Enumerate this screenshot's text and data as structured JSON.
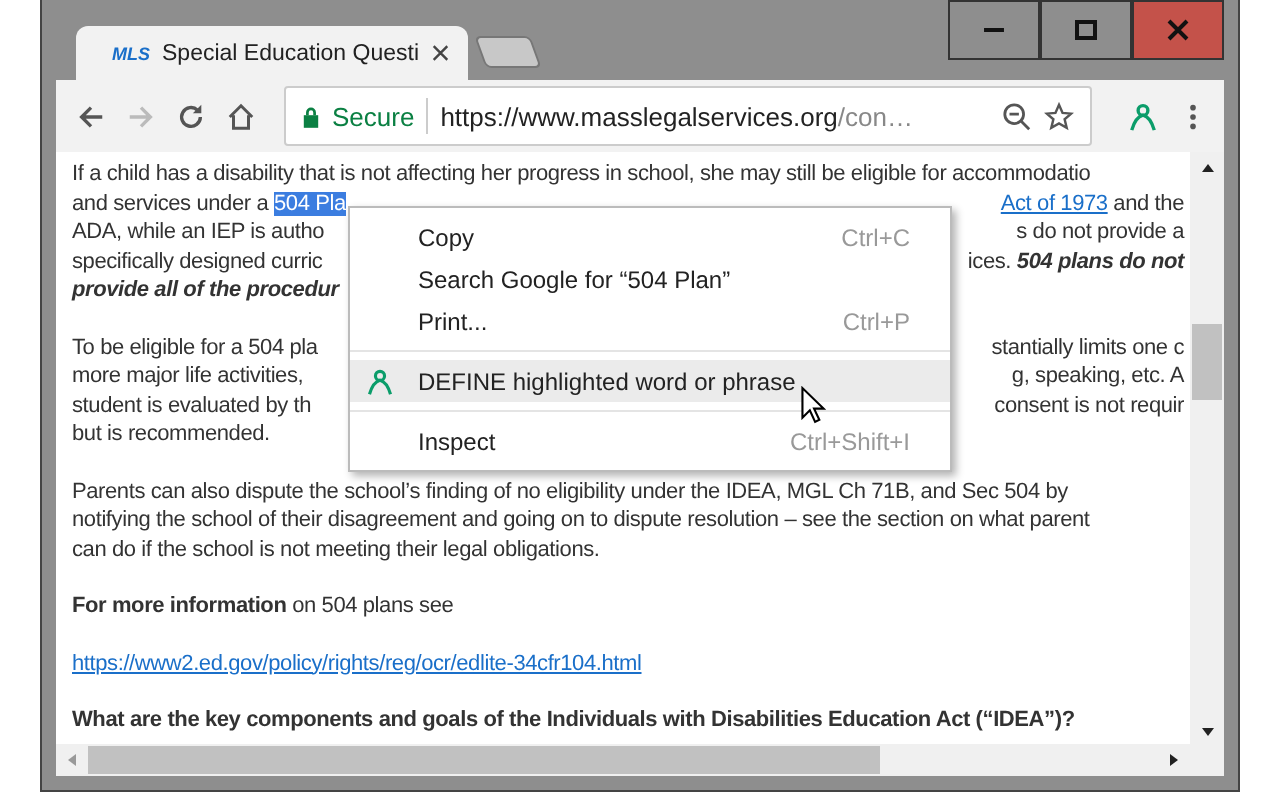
{
  "tab": {
    "favicon": "MLS",
    "title": "Special Education Questi",
    "selected": true
  },
  "address": {
    "secure_label": "Secure",
    "url_host": "https://www.masslegalservices.org",
    "url_path": "/con…"
  },
  "content": {
    "paragraphs": [
      {
        "lines": [
          {
            "left": [
              {
                "kind": "plain",
                "text": "If a child has a disability that is not affecting her progress in school, she may still be eligible for accommodatio"
              }
            ]
          },
          {
            "left": [
              {
                "kind": "plain",
                "text": "and services under a "
              },
              {
                "kind": "highlight",
                "text": "504 Pla"
              }
            ],
            "right": [
              {
                "kind": "link",
                "text": "Act of 1973"
              },
              {
                "kind": "plain",
                "text": " and the"
              }
            ]
          },
          {
            "left": [
              {
                "kind": "plain",
                "text": "ADA, while an IEP is autho"
              }
            ],
            "right": [
              {
                "kind": "plain",
                "text": "s do not provide a"
              }
            ]
          },
          {
            "left": [
              {
                "kind": "plain",
                "text": "specifically designed curric"
              }
            ],
            "right": [
              {
                "kind": "plain",
                "text": "ices. "
              },
              {
                "kind": "bold_italic",
                "text": "504 plans do not"
              }
            ]
          },
          {
            "left": [
              {
                "kind": "bold_italic",
                "text": "provide all of the  procedur"
              }
            ]
          }
        ]
      },
      {
        "lines": [
          {
            "left": [
              {
                "kind": "plain",
                "text": "To be eligible for a 504 pla"
              }
            ],
            "right": [
              {
                "kind": "plain",
                "text": "stantially limits one c"
              }
            ]
          },
          {
            "left": [
              {
                "kind": "plain",
                "text": "more major life activities,"
              }
            ],
            "right": [
              {
                "kind": "plain",
                "text": "g, speaking, etc. A"
              }
            ]
          },
          {
            "left": [
              {
                "kind": "plain",
                "text": "student is evaluated by th"
              }
            ],
            "right": [
              {
                "kind": "plain",
                "text": "consent is not requir"
              }
            ]
          },
          {
            "left": [
              {
                "kind": "plain",
                "text": "but is recommended."
              }
            ]
          }
        ]
      },
      {
        "lines": [
          {
            "left": [
              {
                "kind": "plain",
                "text": "Parents can also dispute the school’s finding of no eligibility under the IDEA, MGL Ch 71B, and Sec 504  by"
              }
            ]
          },
          {
            "left": [
              {
                "kind": "plain",
                "text": "notifying the school of their disagreement and going on to dispute resolution – see the section on what parent"
              }
            ]
          },
          {
            "left": [
              {
                "kind": "plain",
                "text": "can do if the school is not meeting their legal obligations."
              }
            ]
          }
        ]
      },
      {
        "lines": [
          {
            "left": [
              {
                "kind": "bold",
                "text": "For more information"
              },
              {
                "kind": "plain",
                "text": " on 504 plans see"
              }
            ]
          }
        ]
      },
      {
        "lines": [
          {
            "left": [
              {
                "kind": "link",
                "text": "https://www2.ed.gov/policy/rights/reg/ocr/edlite-34cfr104.html"
              }
            ]
          }
        ]
      },
      {
        "lines": [
          {
            "left": [
              {
                "kind": "bold",
                "text": "What are the key components and goals of the Individuals with Disabilities Education Act (“IDEA”)?"
              }
            ]
          }
        ]
      }
    ]
  },
  "context_menu": {
    "items": [
      {
        "kind": "item",
        "label": "Copy",
        "shortcut": "Ctrl+C",
        "selected": false
      },
      {
        "kind": "item",
        "label": "Search Google for “504 Plan”",
        "selected": false
      },
      {
        "kind": "item",
        "label": "Print...",
        "shortcut": "Ctrl+P",
        "selected": false
      },
      {
        "kind": "separator"
      },
      {
        "kind": "extension",
        "label": "DEFINE highlighted word or phrase",
        "selected": true
      },
      {
        "kind": "separator"
      },
      {
        "kind": "item",
        "label": "Inspect",
        "shortcut": "Ctrl+Shift+I",
        "selected": false
      }
    ]
  }
}
